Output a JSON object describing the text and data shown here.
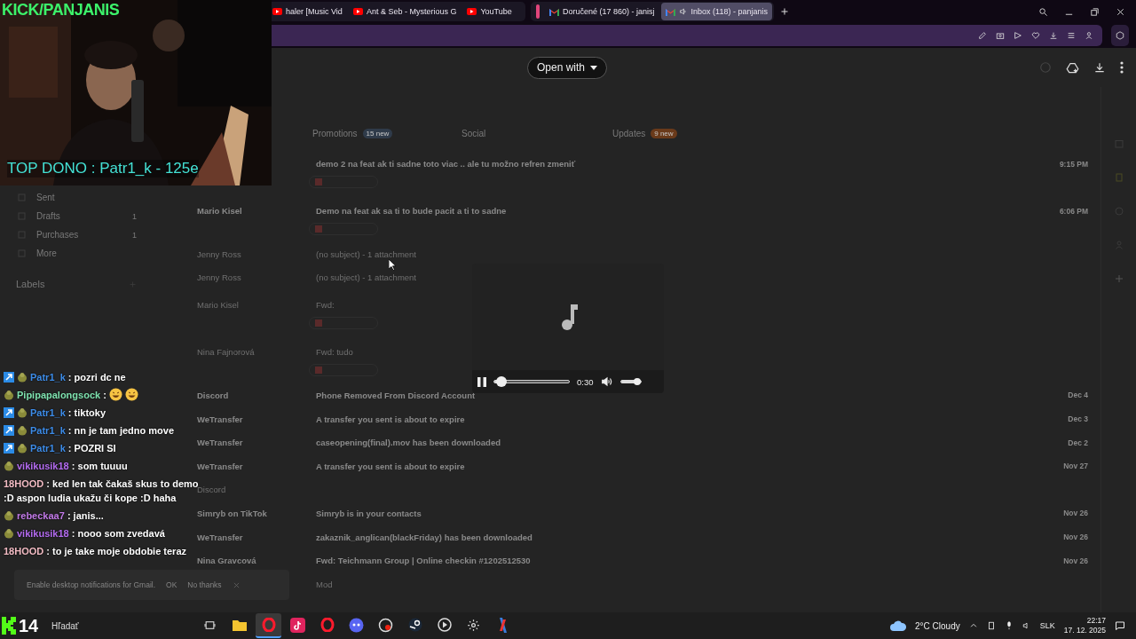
{
  "stream_overlay": {
    "channel": "KICK/PANJANIS",
    "top_donor": "TOP DONO : Patr1_k - 125e"
  },
  "browser": {
    "tab_groups": [
      {
        "marked": false,
        "tabs": [
          {
            "title": "haler [Music Vid",
            "kind": "video",
            "selected": false,
            "audible": false
          },
          {
            "title": "Ant & Seb - Mysterious G",
            "kind": "video",
            "selected": false,
            "audible": false
          },
          {
            "title": "YouTube",
            "kind": "video",
            "selected": false,
            "audible": false
          }
        ]
      },
      {
        "marked": true,
        "tabs": [
          {
            "title": "Doručené (17 860) - janisj",
            "kind": "mail",
            "selected": false,
            "audible": false
          },
          {
            "title": "Inbox (118) - panjanis",
            "kind": "mail",
            "selected": true,
            "audible": true
          }
        ]
      }
    ]
  },
  "viewer": {
    "open_with": "Open with"
  },
  "gmail": {
    "sidebar": [
      {
        "label": "Sent"
      },
      {
        "label": "Drafts",
        "count": "1"
      },
      {
        "label": "Purchases",
        "count": "1"
      },
      {
        "label": "More"
      }
    ],
    "labels_heading": "Labels",
    "categories": [
      {
        "label": "Promotions",
        "badge": "15 new",
        "selected": false
      },
      {
        "label": "Social",
        "selected": false
      },
      {
        "label": "Updates",
        "badge": "9 new",
        "selected": false
      }
    ],
    "emails": [
      {
        "subject": "demo 2 na feat ak ti sadne toto viac .. ale tu možno refren zmeniť",
        "date": "9:15 PM",
        "unread": true,
        "attachment": true
      },
      {
        "sender": "Mario Kisel",
        "subject": "Demo na feat ak sa ti to bude pacit a ti to sadne",
        "date": "6:06 PM",
        "unread": true,
        "attachment": true
      },
      {
        "sender": "Jenny Ross",
        "subject": "(no subject) - 1 attachment",
        "unread": false
      },
      {
        "sender": "Jenny Ross",
        "subject": "(no subject) - 1 attachment",
        "unread": false
      },
      {
        "sender": "Mario Kisel",
        "subject": "Fwd:",
        "unread": false,
        "attachment": true
      },
      {
        "sender": "Nina Fajnorová",
        "subject": "Fwd: tudo",
        "unread": false,
        "attachment": true
      },
      {
        "sender": "Discord",
        "subject": "Phone Removed From Discord Account",
        "date": "Dec 4",
        "unread": true
      },
      {
        "sender": "WeTransfer",
        "subject": "A transfer you sent is about to expire",
        "date": "Dec 3",
        "unread": true
      },
      {
        "sender": "WeTransfer",
        "subject": "caseopening(final).mov has been downloaded",
        "date": "Dec 2",
        "unread": true
      },
      {
        "sender": "WeTransfer",
        "subject": "A transfer you sent is about to expire",
        "date": "Nov 27",
        "unread": true
      },
      {
        "sender": "Discord",
        "unread": false
      },
      {
        "sender": "Simryb on TikTok",
        "subject": "Simryb is in your contacts",
        "date": "Nov 26",
        "unread": true
      },
      {
        "sender": "WeTransfer",
        "subject": "zakaznik_anglican(blackFriday) has been downloaded",
        "date": "Nov 26",
        "unread": true
      },
      {
        "sender": "Nina Gravcová",
        "subject": "Fwd: Teichmann Group | Online checkin #1202512530",
        "date": "Nov 26",
        "unread": true
      },
      {
        "subject": "Mod",
        "unread": false
      }
    ],
    "notification": {
      "text": "Enable desktop notifications for Gmail.",
      "ok": "OK",
      "dismiss": "No thanks"
    }
  },
  "player": {
    "playing": true,
    "progress": {
      "level": 0.1
    },
    "time": "0:30",
    "volume": {
      "level": 0.85
    }
  },
  "chat": [
    {
      "user": "Patr1_k",
      "color": "#3d8ce8",
      "badges": [
        {
          "kind": "sub"
        },
        {
          "kind": "emote"
        }
      ],
      "separator": ":",
      "text": "pozri dc ne"
    },
    {
      "user": "Pipipapalongsock",
      "color": "#7fe3b0",
      "badges": [
        {
          "kind": "emote"
        }
      ],
      "separator": ":",
      "emotes": [
        {
          "kind": "laugh"
        },
        {
          "kind": "laugh"
        }
      ]
    },
    {
      "user": "Patr1_k",
      "color": "#3d8ce8",
      "badges": [
        {
          "kind": "sub"
        },
        {
          "kind": "emote"
        }
      ],
      "separator": ":",
      "text": "tiktoky"
    },
    {
      "user": "Patr1_k",
      "color": "#3d8ce8",
      "badges": [
        {
          "kind": "sub"
        },
        {
          "kind": "emote"
        }
      ],
      "separator": ":",
      "text": "nn je tam jedno move"
    },
    {
      "user": "Patr1_k",
      "color": "#3d8ce8",
      "badges": [
        {
          "kind": "sub"
        },
        {
          "kind": "emote"
        }
      ],
      "separator": ":",
      "text": "POZRI SI"
    },
    {
      "user": "vikikusik18",
      "color": "#b46cf0",
      "badges": [
        {
          "kind": "emote"
        }
      ],
      "separator": ":",
      "text": "som tuuuu"
    },
    {
      "user": "18HOOD",
      "color": "#f3bcc4",
      "separator": ":",
      "text": "ked len tak čakaš skus to demo :D aspon ludia ukažu či kope :D haha"
    },
    {
      "user": "rebeckaa7",
      "color": "#c27ae8",
      "badges": [
        {
          "kind": "emote"
        }
      ],
      "separator": ":",
      "text": "janis..."
    },
    {
      "user": "vikikusik18",
      "color": "#b46cf0",
      "badges": [
        {
          "kind": "emote"
        }
      ],
      "separator": ":",
      "text": "nooo som zvedavá"
    },
    {
      "user": "18HOOD",
      "color": "#f3bcc4",
      "separator": ":",
      "text": "to je take moje obdobie teraz"
    }
  ],
  "taskbar": {
    "counter": "14",
    "search": {
      "placeholder": "Hľadať"
    },
    "apps": [
      {
        "kind": "taskview",
        "selected": false
      },
      {
        "kind": "files",
        "selected": false
      },
      {
        "kind": "opera",
        "selected": true
      },
      {
        "kind": "tiktok",
        "selected": false
      },
      {
        "kind": "opera",
        "selected": false
      },
      {
        "kind": "discord",
        "selected": false
      },
      {
        "kind": "obs",
        "selected": false
      },
      {
        "kind": "steam",
        "selected": false
      },
      {
        "kind": "player",
        "selected": false
      },
      {
        "kind": "settings",
        "selected": false
      },
      {
        "kind": "tool",
        "selected": false
      }
    ],
    "weather": "2°C  Cloudy",
    "language": "SLK",
    "time": "22:17",
    "date": "17. 12. 2025"
  }
}
